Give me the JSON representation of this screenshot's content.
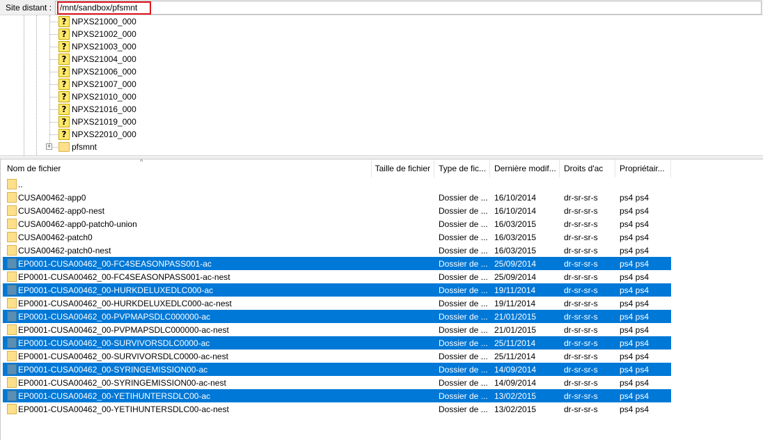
{
  "remote_site": {
    "label": "Site distant :",
    "path": "/mnt/sandbox/pfsmnt"
  },
  "tree": {
    "items": [
      {
        "label": "NPXS21000_000",
        "icon": "question-folder-icon"
      },
      {
        "label": "NPXS21002_000",
        "icon": "question-folder-icon"
      },
      {
        "label": "NPXS21003_000",
        "icon": "question-folder-icon"
      },
      {
        "label": "NPXS21004_000",
        "icon": "question-folder-icon"
      },
      {
        "label": "NPXS21006_000",
        "icon": "question-folder-icon"
      },
      {
        "label": "NPXS21007_000",
        "icon": "question-folder-icon"
      },
      {
        "label": "NPXS21010_000",
        "icon": "question-folder-icon"
      },
      {
        "label": "NPXS21016_000",
        "icon": "question-folder-icon"
      },
      {
        "label": "NPXS21019_000",
        "icon": "question-folder-icon"
      },
      {
        "label": "NPXS22010_000",
        "icon": "question-folder-icon"
      },
      {
        "label": "pfsmnt",
        "icon": "folder-icon",
        "expander": "+"
      }
    ],
    "question_glyph": "?"
  },
  "list": {
    "columns": {
      "name": "Nom de fichier",
      "size": "Taille de fichier",
      "type": "Type de fic...",
      "modified": "Dernière modif...",
      "perms": "Droits d'ac",
      "owner": "Propriétair..."
    },
    "sort_glyph": "^",
    "rows": [
      {
        "name": "..",
        "type": "",
        "date": "",
        "perms": "",
        "owner": "",
        "selected": false
      },
      {
        "name": "CUSA00462-app0",
        "type": "Dossier de ...",
        "date": "16/10/2014",
        "perms": "dr-sr-sr-s",
        "owner": "ps4 ps4",
        "selected": false
      },
      {
        "name": "CUSA00462-app0-nest",
        "type": "Dossier de ...",
        "date": "16/10/2014",
        "perms": "dr-sr-sr-s",
        "owner": "ps4 ps4",
        "selected": false
      },
      {
        "name": "CUSA00462-app0-patch0-union",
        "type": "Dossier de ...",
        "date": "16/03/2015",
        "perms": "dr-sr-sr-s",
        "owner": "ps4 ps4",
        "selected": false
      },
      {
        "name": "CUSA00462-patch0",
        "type": "Dossier de ...",
        "date": "16/03/2015",
        "perms": "dr-sr-sr-s",
        "owner": "ps4 ps4",
        "selected": false
      },
      {
        "name": "CUSA00462-patch0-nest",
        "type": "Dossier de ...",
        "date": "16/03/2015",
        "perms": "dr-sr-sr-s",
        "owner": "ps4 ps4",
        "selected": false
      },
      {
        "name": "EP0001-CUSA00462_00-FC4SEASONPASS001-ac",
        "type": "Dossier de ...",
        "date": "25/09/2014",
        "perms": "dr-sr-sr-s",
        "owner": "ps4 ps4",
        "selected": true
      },
      {
        "name": "EP0001-CUSA00462_00-FC4SEASONPASS001-ac-nest",
        "type": "Dossier de ...",
        "date": "25/09/2014",
        "perms": "dr-sr-sr-s",
        "owner": "ps4 ps4",
        "selected": false
      },
      {
        "name": "EP0001-CUSA00462_00-HURKDELUXEDLC000-ac",
        "type": "Dossier de ...",
        "date": "19/11/2014",
        "perms": "dr-sr-sr-s",
        "owner": "ps4 ps4",
        "selected": true
      },
      {
        "name": "EP0001-CUSA00462_00-HURKDELUXEDLC000-ac-nest",
        "type": "Dossier de ...",
        "date": "19/11/2014",
        "perms": "dr-sr-sr-s",
        "owner": "ps4 ps4",
        "selected": false
      },
      {
        "name": "EP0001-CUSA00462_00-PVPMAPSDLC000000-ac",
        "type": "Dossier de ...",
        "date": "21/01/2015",
        "perms": "dr-sr-sr-s",
        "owner": "ps4 ps4",
        "selected": true
      },
      {
        "name": "EP0001-CUSA00462_00-PVPMAPSDLC000000-ac-nest",
        "type": "Dossier de ...",
        "date": "21/01/2015",
        "perms": "dr-sr-sr-s",
        "owner": "ps4 ps4",
        "selected": false
      },
      {
        "name": "EP0001-CUSA00462_00-SURVIVORSDLC0000-ac",
        "type": "Dossier de ...",
        "date": "25/11/2014",
        "perms": "dr-sr-sr-s",
        "owner": "ps4 ps4",
        "selected": true
      },
      {
        "name": "EP0001-CUSA00462_00-SURVIVORSDLC0000-ac-nest",
        "type": "Dossier de ...",
        "date": "25/11/2014",
        "perms": "dr-sr-sr-s",
        "owner": "ps4 ps4",
        "selected": false
      },
      {
        "name": "EP0001-CUSA00462_00-SYRINGEMISSION00-ac",
        "type": "Dossier de ...",
        "date": "14/09/2014",
        "perms": "dr-sr-sr-s",
        "owner": "ps4 ps4",
        "selected": true
      },
      {
        "name": "EP0001-CUSA00462_00-SYRINGEMISSION00-ac-nest",
        "type": "Dossier de ...",
        "date": "14/09/2014",
        "perms": "dr-sr-sr-s",
        "owner": "ps4 ps4",
        "selected": false
      },
      {
        "name": "EP0001-CUSA00462_00-YETIHUNTERSDLC00-ac",
        "type": "Dossier de ...",
        "date": "13/02/2015",
        "perms": "dr-sr-sr-s",
        "owner": "ps4 ps4",
        "selected": true
      },
      {
        "name": "EP0001-CUSA00462_00-YETIHUNTERSDLC00-ac-nest",
        "type": "Dossier de ...",
        "date": "13/02/2015",
        "perms": "dr-sr-sr-s",
        "owner": "ps4 ps4",
        "selected": false
      }
    ]
  },
  "colors": {
    "selection": "#0078d7",
    "highlight_border": "#e0141c",
    "folder": "#ffe08a"
  }
}
